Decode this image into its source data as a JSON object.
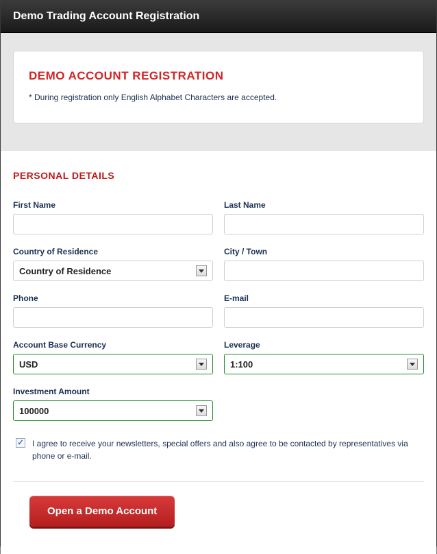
{
  "window": {
    "title": "Demo Trading Account Registration"
  },
  "header_box": {
    "title": "DEMO ACCOUNT REGISTRATION",
    "note": "* During registration only English Alphabet Characters are accepted."
  },
  "section": {
    "title": "PERSONAL DETAILS"
  },
  "fields": {
    "first_name": {
      "label": "First Name",
      "value": ""
    },
    "last_name": {
      "label": "Last Name",
      "value": ""
    },
    "country": {
      "label": "Country of Residence",
      "selected": "Country of Residence"
    },
    "city": {
      "label": "City / Town",
      "value": ""
    },
    "phone": {
      "label": "Phone",
      "value": ""
    },
    "email": {
      "label": "E-mail",
      "value": ""
    },
    "currency": {
      "label": "Account Base Currency",
      "selected": "USD"
    },
    "leverage": {
      "label": "Leverage",
      "selected": "1:100"
    },
    "investment": {
      "label": "Investment Amount",
      "selected": "100000"
    }
  },
  "consent": {
    "checked": true,
    "text": "I agree to receive your newsletters, special offers and also agree to be contacted by representatives via phone or e-mail."
  },
  "submit": {
    "label": "Open a Demo Account"
  }
}
